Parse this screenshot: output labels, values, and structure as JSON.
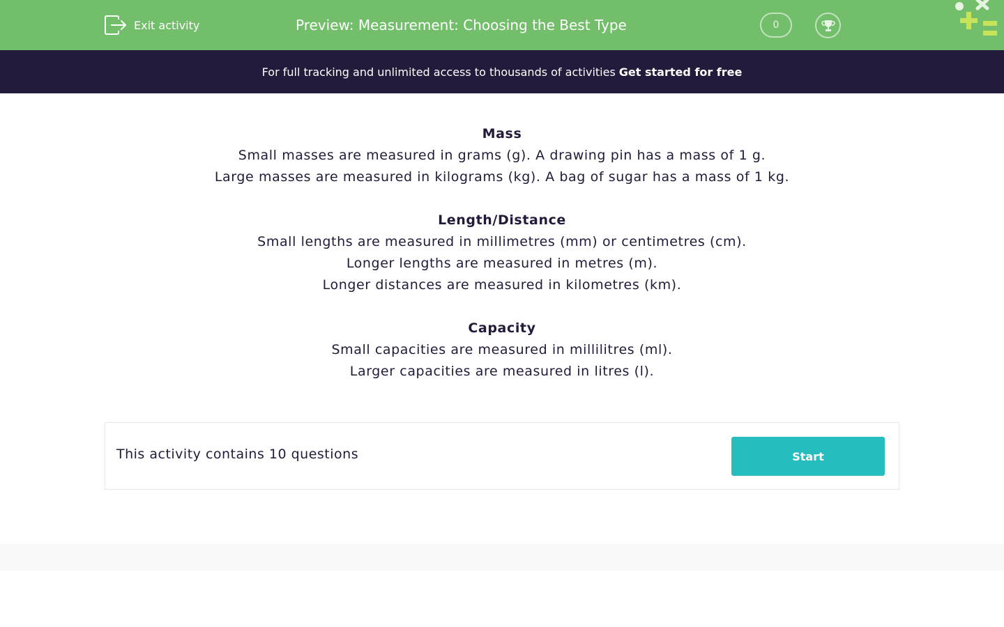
{
  "header": {
    "exit_label": "Exit activity",
    "title": "Preview: Measurement: Choosing the Best Type",
    "score": "0",
    "colors": {
      "bar": "#72be6a",
      "logo_cross": "#c6e35a"
    }
  },
  "promo": {
    "text": "For full tracking and unlimited access to thousands of activities",
    "cta": "Get started for free"
  },
  "sections": [
    {
      "heading": "Mass",
      "lines": [
        "Small masses are measured in grams (g).  A drawing pin has a mass of 1 g.",
        "Large masses are measured in kilograms (kg).  A bag of sugar has a mass of 1 kg."
      ]
    },
    {
      "heading": "Length/Distance",
      "lines": [
        "Small lengths are measured in millimetres (mm) or centimetres (cm).",
        "Longer lengths are measured in metres (m).",
        "Longer distances are measured in kilometres (km)."
      ]
    },
    {
      "heading": "Capacity",
      "lines": [
        "Small capacities are measured in millilitres (ml).",
        "Larger capacities are measured in litres (l)."
      ]
    }
  ],
  "activity": {
    "count_text": "This activity contains 10 questions",
    "start_label": "Start",
    "start_color": "#27bdbf"
  }
}
